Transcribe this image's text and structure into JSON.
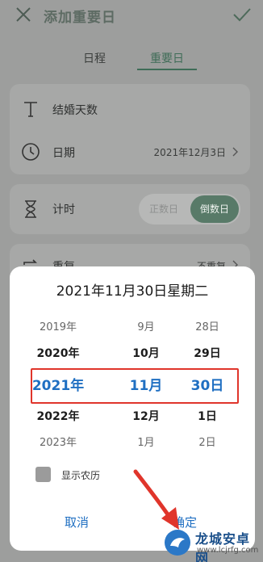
{
  "header": {
    "title": "添加重要日"
  },
  "tabs": [
    {
      "label": "日程"
    },
    {
      "label": "重要日"
    }
  ],
  "card1": {
    "name_label": "结婚天数",
    "date_label": "日期",
    "date_value": "2021年12月3日"
  },
  "card2": {
    "label": "计时",
    "toggle": {
      "count_up": "正数日",
      "count_down": "倒数日",
      "selected": "倒数日"
    }
  },
  "card3": {
    "label": "重复",
    "value": "不重复"
  },
  "picker": {
    "title": "2021年11月30日星期二",
    "years": [
      "2019年",
      "2020年",
      "2021年",
      "2022年",
      "2023年"
    ],
    "months": [
      "9月",
      "10月",
      "11月",
      "12月",
      "1月"
    ],
    "days": [
      "28日",
      "29日",
      "30日",
      "1日",
      "2日"
    ],
    "lunar_label": "显示农历",
    "cancel": "取消",
    "confirm": "确定"
  },
  "colors": {
    "accent": "#1f6fc2",
    "highlight_border": "#e0352b",
    "arrow": "#e0352b",
    "toggle_active": "#587a68"
  },
  "watermark": {
    "name": "龙城安卓网",
    "url": "www.lcjrfg.com"
  }
}
